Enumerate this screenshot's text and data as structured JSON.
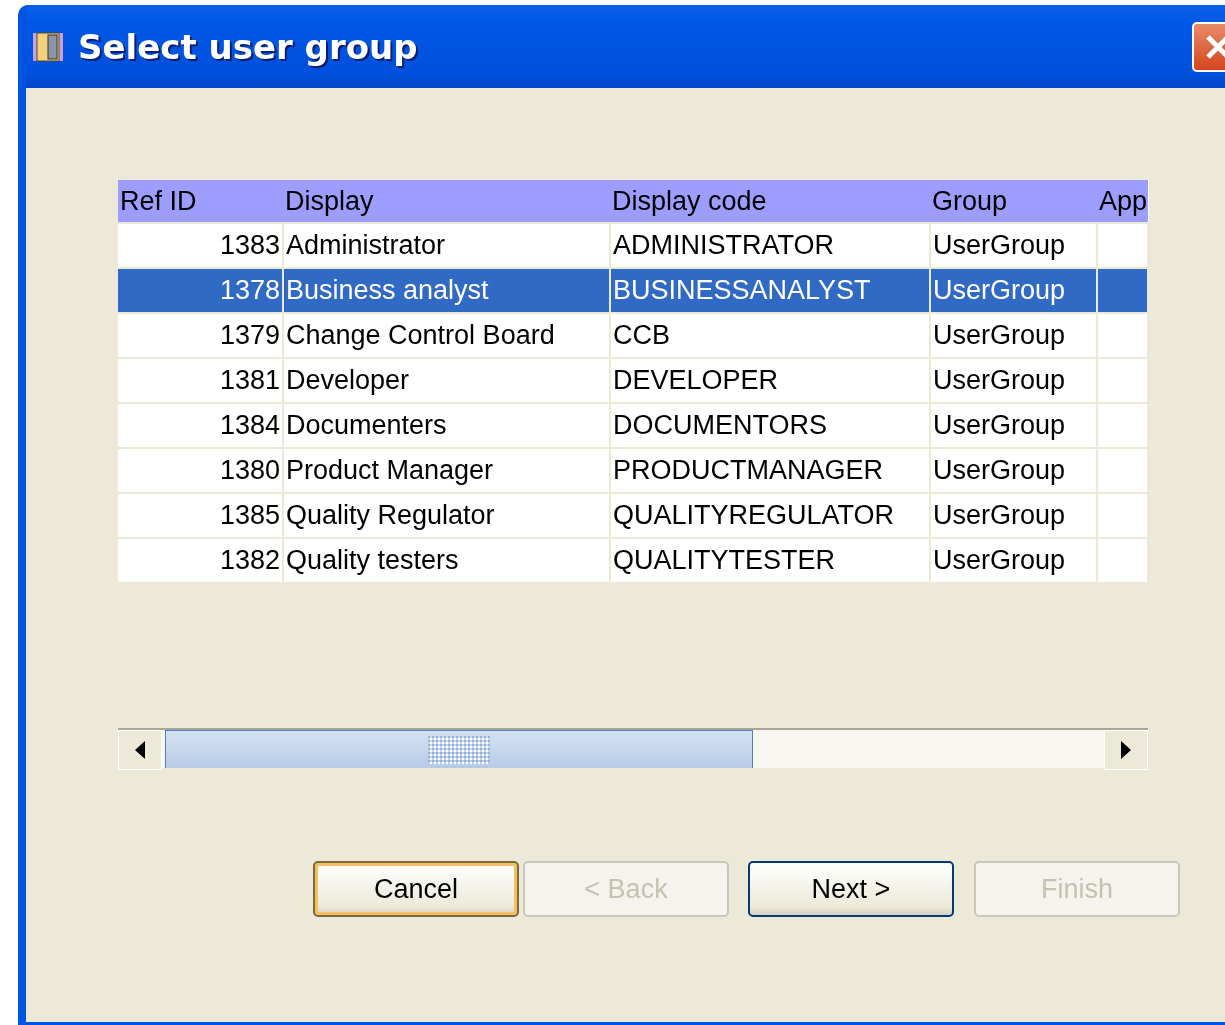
{
  "window": {
    "title": "Select user group"
  },
  "table": {
    "columns": [
      "Ref ID",
      "Display",
      "Display code",
      "Group",
      "App"
    ],
    "rows": [
      {
        "ref_id": "1383",
        "display": "Administrator",
        "display_code": "ADMINISTRATOR",
        "group": "UserGroup",
        "selected": false
      },
      {
        "ref_id": "1378",
        "display": "Business analyst",
        "display_code": "BUSINESSANALYST",
        "group": "UserGroup",
        "selected": true
      },
      {
        "ref_id": "1379",
        "display": "Change Control Board",
        "display_code": "CCB",
        "group": "UserGroup",
        "selected": false
      },
      {
        "ref_id": "1381",
        "display": "Developer",
        "display_code": "DEVELOPER",
        "group": "UserGroup",
        "selected": false
      },
      {
        "ref_id": "1384",
        "display": "Documenters",
        "display_code": "DOCUMENTORS",
        "group": "UserGroup",
        "selected": false
      },
      {
        "ref_id": "1380",
        "display": "Product Manager",
        "display_code": "PRODUCTMANAGER",
        "group": "UserGroup",
        "selected": false
      },
      {
        "ref_id": "1385",
        "display": "Quality Regulator",
        "display_code": "QUALITYREGULATOR",
        "group": "UserGroup",
        "selected": false
      },
      {
        "ref_id": "1382",
        "display": "Quality testers",
        "display_code": "QUALITYTESTER",
        "group": "UserGroup",
        "selected": false
      }
    ]
  },
  "buttons": [
    {
      "label": "Cancel",
      "disabled": false,
      "focused": true
    },
    {
      "label": "< Back",
      "disabled": true,
      "focused": false
    },
    {
      "label": "Next >",
      "disabled": false,
      "focused": false
    },
    {
      "label": "Finish",
      "disabled": true,
      "focused": false
    }
  ]
}
